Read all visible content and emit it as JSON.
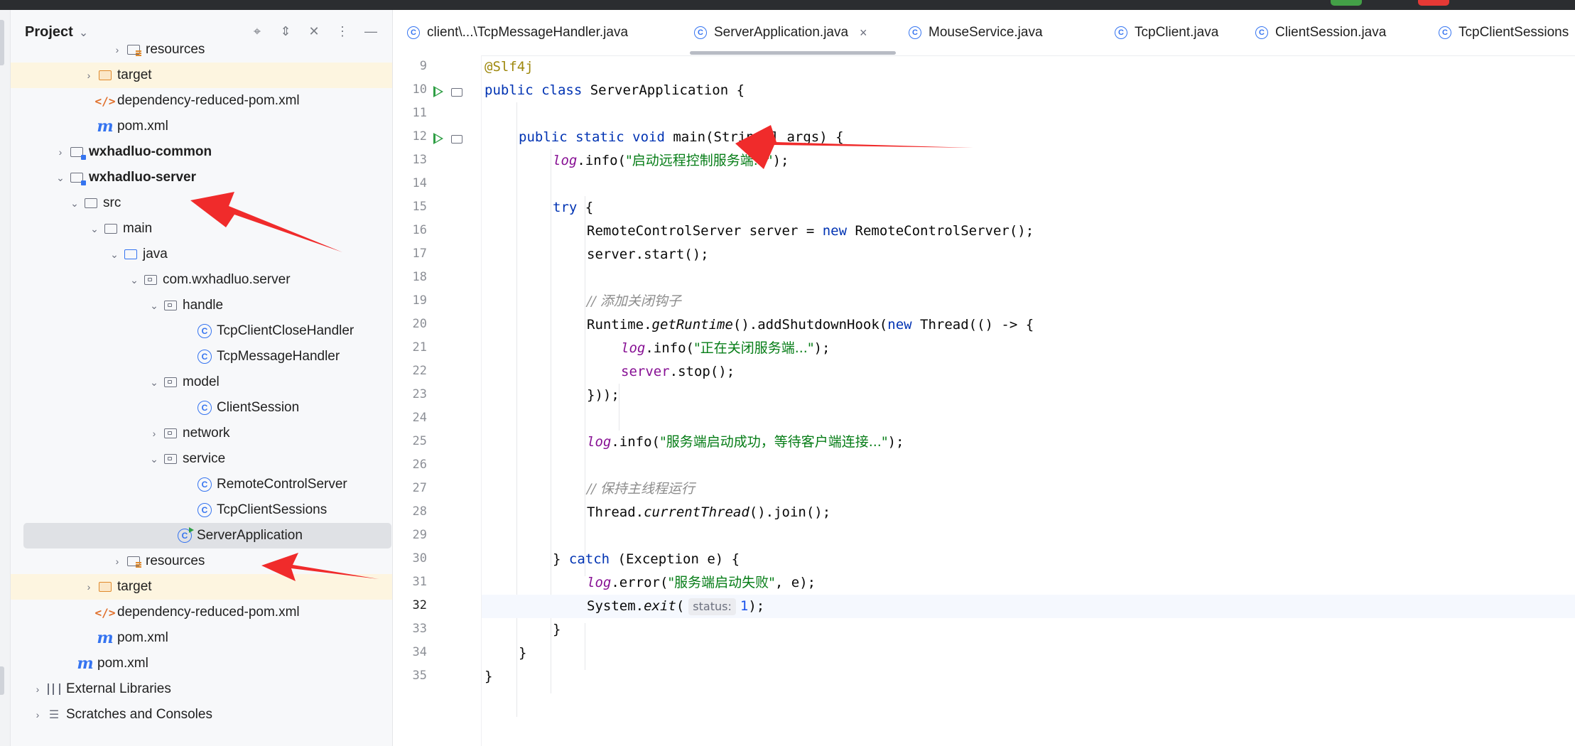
{
  "project_panel": {
    "title": "Project",
    "tree": [
      {
        "label": "resources",
        "icon": "resources-folder-icon",
        "chev": "›"
      },
      {
        "label": "target",
        "icon": "excluded-folder-icon",
        "chev": "›"
      },
      {
        "label": "dependency-reduced-pom.xml",
        "icon": "xml-file-icon",
        "chev": ""
      },
      {
        "label": "pom.xml",
        "icon": "maven-icon",
        "chev": ""
      },
      {
        "label": "wxhadluo-common",
        "icon": "module-icon",
        "chev": "›"
      },
      {
        "label": "wxhadluo-server",
        "icon": "module-icon",
        "chev": "⌄"
      },
      {
        "label": "src",
        "icon": "folder-icon",
        "chev": "⌄"
      },
      {
        "label": "main",
        "icon": "folder-icon",
        "chev": "⌄"
      },
      {
        "label": "java",
        "icon": "source-folder-icon",
        "chev": "⌄"
      },
      {
        "label": "com.wxhadluo.server",
        "icon": "package-icon",
        "chev": "⌄"
      },
      {
        "label": "handle",
        "icon": "package-icon",
        "chev": "⌄"
      },
      {
        "label": "TcpClientCloseHandler",
        "icon": "class-icon",
        "chev": ""
      },
      {
        "label": "TcpMessageHandler",
        "icon": "class-icon",
        "chev": ""
      },
      {
        "label": "model",
        "icon": "package-icon",
        "chev": "⌄"
      },
      {
        "label": "ClientSession",
        "icon": "class-icon",
        "chev": ""
      },
      {
        "label": "network",
        "icon": "package-icon",
        "chev": "›"
      },
      {
        "label": "service",
        "icon": "package-icon",
        "chev": "⌄"
      },
      {
        "label": "RemoteControlServer",
        "icon": "class-icon",
        "chev": ""
      },
      {
        "label": "TcpClientSessions",
        "icon": "class-icon",
        "chev": ""
      },
      {
        "label": "ServerApplication",
        "icon": "runnable-class-icon",
        "chev": ""
      },
      {
        "label": "resources",
        "icon": "resources-folder-icon",
        "chev": "›"
      },
      {
        "label": "target",
        "icon": "excluded-folder-icon",
        "chev": "›"
      },
      {
        "label": "dependency-reduced-pom.xml",
        "icon": "xml-file-icon",
        "chev": ""
      },
      {
        "label": "pom.xml",
        "icon": "maven-icon",
        "chev": ""
      },
      {
        "label": "pom.xml",
        "icon": "maven-icon",
        "chev": ""
      },
      {
        "label": "External Libraries",
        "icon": "libraries-icon",
        "chev": "›"
      },
      {
        "label": "Scratches and Consoles",
        "icon": "scratches-icon",
        "chev": "›"
      }
    ]
  },
  "tabs": [
    {
      "label": "client\\...\\TcpMessageHandler.java"
    },
    {
      "label": "ServerApplication.java",
      "active": true
    },
    {
      "label": "MouseService.java"
    },
    {
      "label": "TcpClient.java"
    },
    {
      "label": "ClientSession.java"
    },
    {
      "label": "TcpClientSessions"
    }
  ],
  "editor": {
    "line_numbers": [
      "9",
      "10",
      "11",
      "12",
      "13",
      "14",
      "15",
      "16",
      "17",
      "18",
      "19",
      "20",
      "21",
      "22",
      "23",
      "24",
      "25",
      "26",
      "27",
      "28",
      "29",
      "30",
      "31",
      "32",
      "33",
      "34",
      "35"
    ],
    "current_line": "32",
    "code": {
      "l9": "@Slf4j",
      "l10_kw": "public class",
      "l10_rest": " ServerApplication {",
      "l12_kw": "public static void",
      "l12_rest": " main(String[] args) {",
      "l13_a": "log",
      "l13_b": ".info(",
      "l13_str": "\"启动远程控制服务端...\"",
      "l13_c": ");",
      "l15_kw": "try",
      "l15_rest": " {",
      "l16_a": "RemoteControlServer server = ",
      "l16_kw": "new",
      "l16_b": " RemoteControlServer();",
      "l17": "server.start();",
      "l19": "// 添加关闭钩子",
      "l20_a": "Runtime.",
      "l20_st": "getRuntime",
      "l20_b": "().addShutdownHook(",
      "l20_kw": "new",
      "l20_c": " Thread(() -> {",
      "l21_a": "log",
      "l21_b": ".info(",
      "l21_str": "\"正在关闭服务端...\"",
      "l21_c": ");",
      "l22_a": "server",
      "l22_b": ".stop();",
      "l23": "}));",
      "l25_a": "log",
      "l25_b": ".info(",
      "l25_str": "\"服务端启动成功，等待客户端连接...\"",
      "l25_c": ");",
      "l27": "// 保持主线程运行",
      "l28_a": "Thread.",
      "l28_st": "currentThread",
      "l28_b": "().join();",
      "l30_a": "} ",
      "l30_kw": "catch",
      "l30_b": " (Exception e) {",
      "l31_a": "log",
      "l31_b": ".error(",
      "l31_str": "\"服务端启动失败\"",
      "l31_c": ", e);",
      "l32_a": "System.",
      "l32_st": "exit",
      "l32_b": "(",
      "l32_hint": "status:",
      "l32_num": "1",
      "l32_c": ");",
      "l33": "}",
      "l34": "}",
      "l35": "}"
    }
  },
  "colors": {
    "keyword": "#0033b3",
    "string": "#067d17",
    "annotation": "#9e880d",
    "field": "#871094",
    "arrow": "#f02b2b"
  }
}
